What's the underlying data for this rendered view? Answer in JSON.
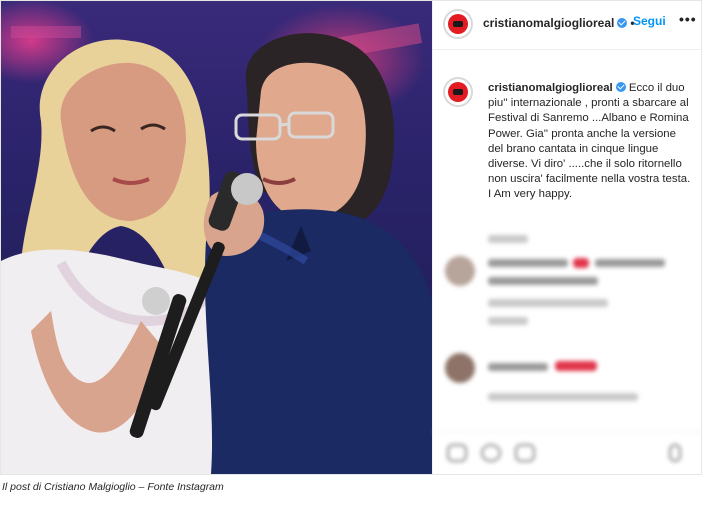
{
  "post": {
    "username": "cristianomalgioglioreal",
    "follow_label": "Segui",
    "more_label": "•••",
    "caption": "Ecco il duo piu'' internazionale , pronti a sbarcare al Festival di Sanremo ...Albano e Romina Power. Gia'' pronta anche la versione del brano cantata in cinque lingue diverse. Vi diro' .....che il solo ritornello non uscira' facilmente nella vostra testa. I Am very happy."
  },
  "credit": "Il post di Cristiano Malgioglio – Fonte Instagram",
  "icons": [
    "verified-badge-icon",
    "more-options-icon",
    "heart-icon",
    "comment-icon",
    "share-icon",
    "save-icon"
  ],
  "colors": {
    "follow": "#0095f6",
    "verified": "#3897f0",
    "avatar_ring": "#e31b23"
  }
}
